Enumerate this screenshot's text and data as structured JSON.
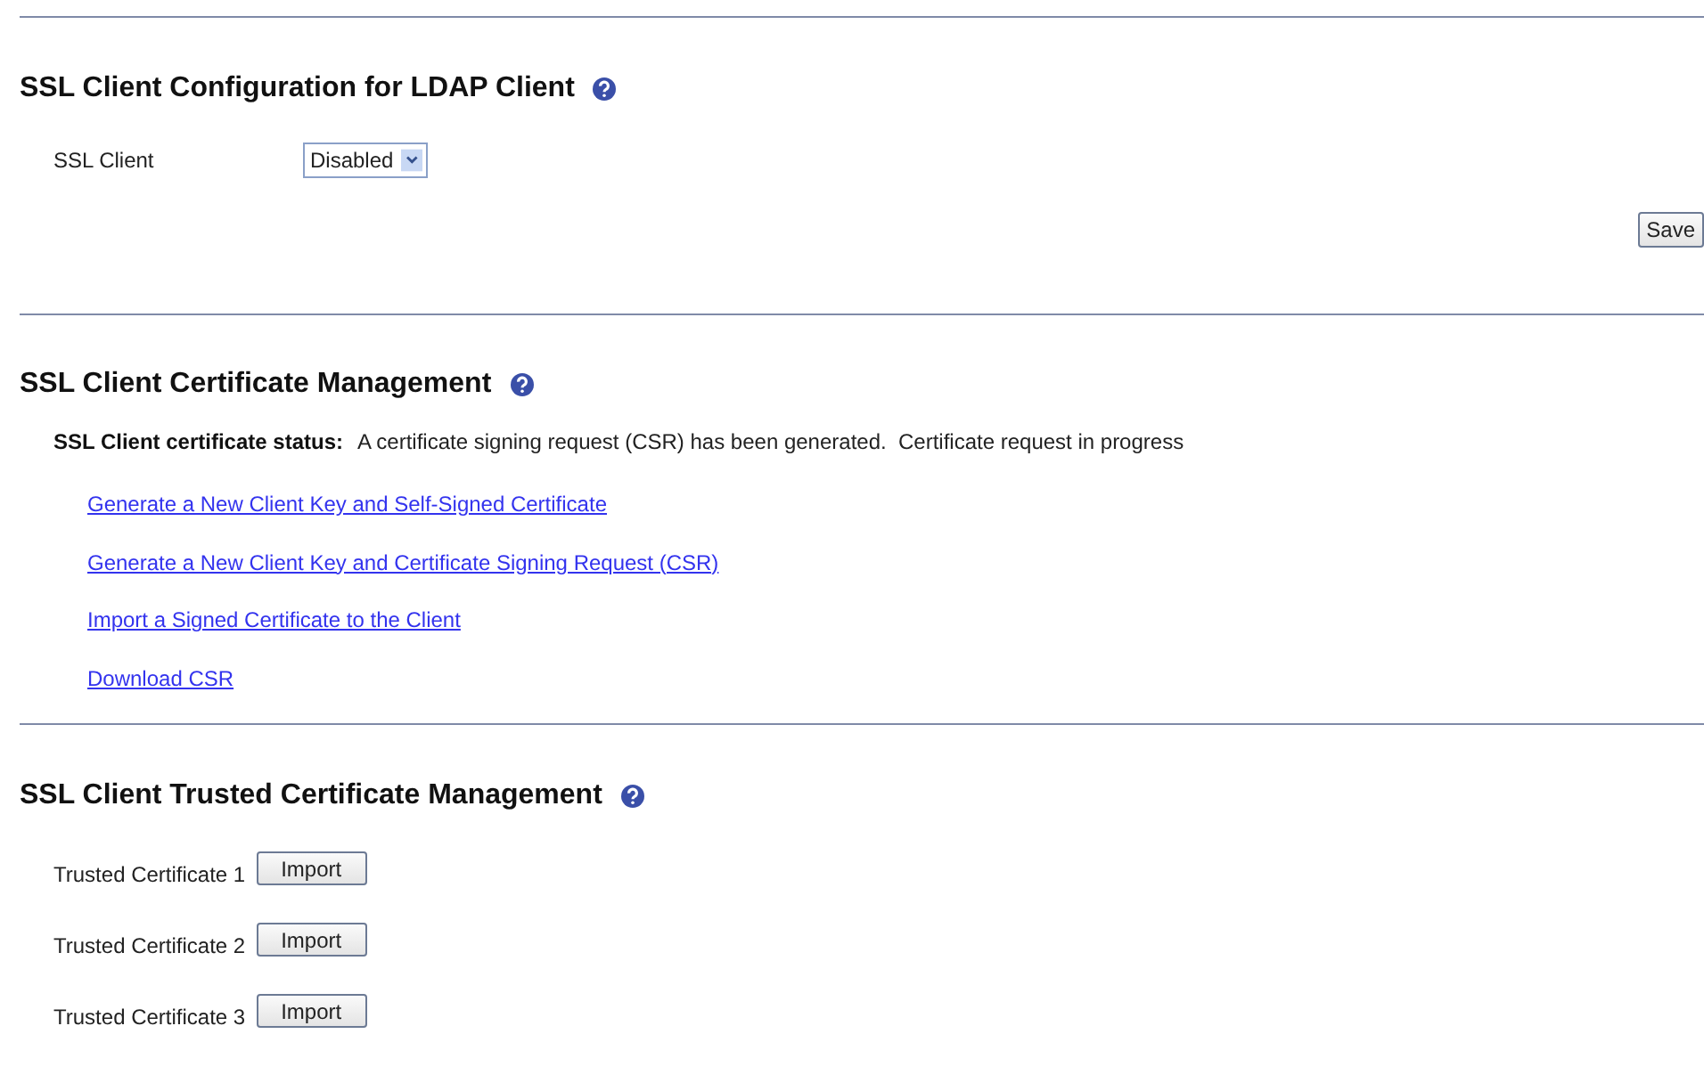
{
  "sections": [
    {
      "kind": "config",
      "title": "SSL Client Configuration for LDAP Client",
      "help": true,
      "fields": [
        {
          "label": "SSL Client",
          "value": "Disabled"
        }
      ],
      "save_button": "Save"
    },
    {
      "kind": "certificate",
      "title": "SSL Client Certificate Management",
      "help": true,
      "status": {
        "label": "SSL Client certificate status:",
        "value": "A certificate signing request (CSR) has been generated.  Certificate request in progress"
      },
      "links": [
        "Generate a New Client Key and Self-Signed Certificate",
        "Generate a New Client Key and Certificate Signing Request (CSR)",
        "Import a Signed Certificate to the Client",
        "Download CSR"
      ]
    },
    {
      "kind": "trusted",
      "title": "SSL Client Trusted Certificate Management",
      "help": true,
      "certificates": [
        {
          "label": "Trusted Certificate 1",
          "button": "Import"
        },
        {
          "label": "Trusted Certificate 2",
          "button": "Import"
        },
        {
          "label": "Trusted Certificate 3",
          "button": "Import"
        }
      ]
    }
  ]
}
